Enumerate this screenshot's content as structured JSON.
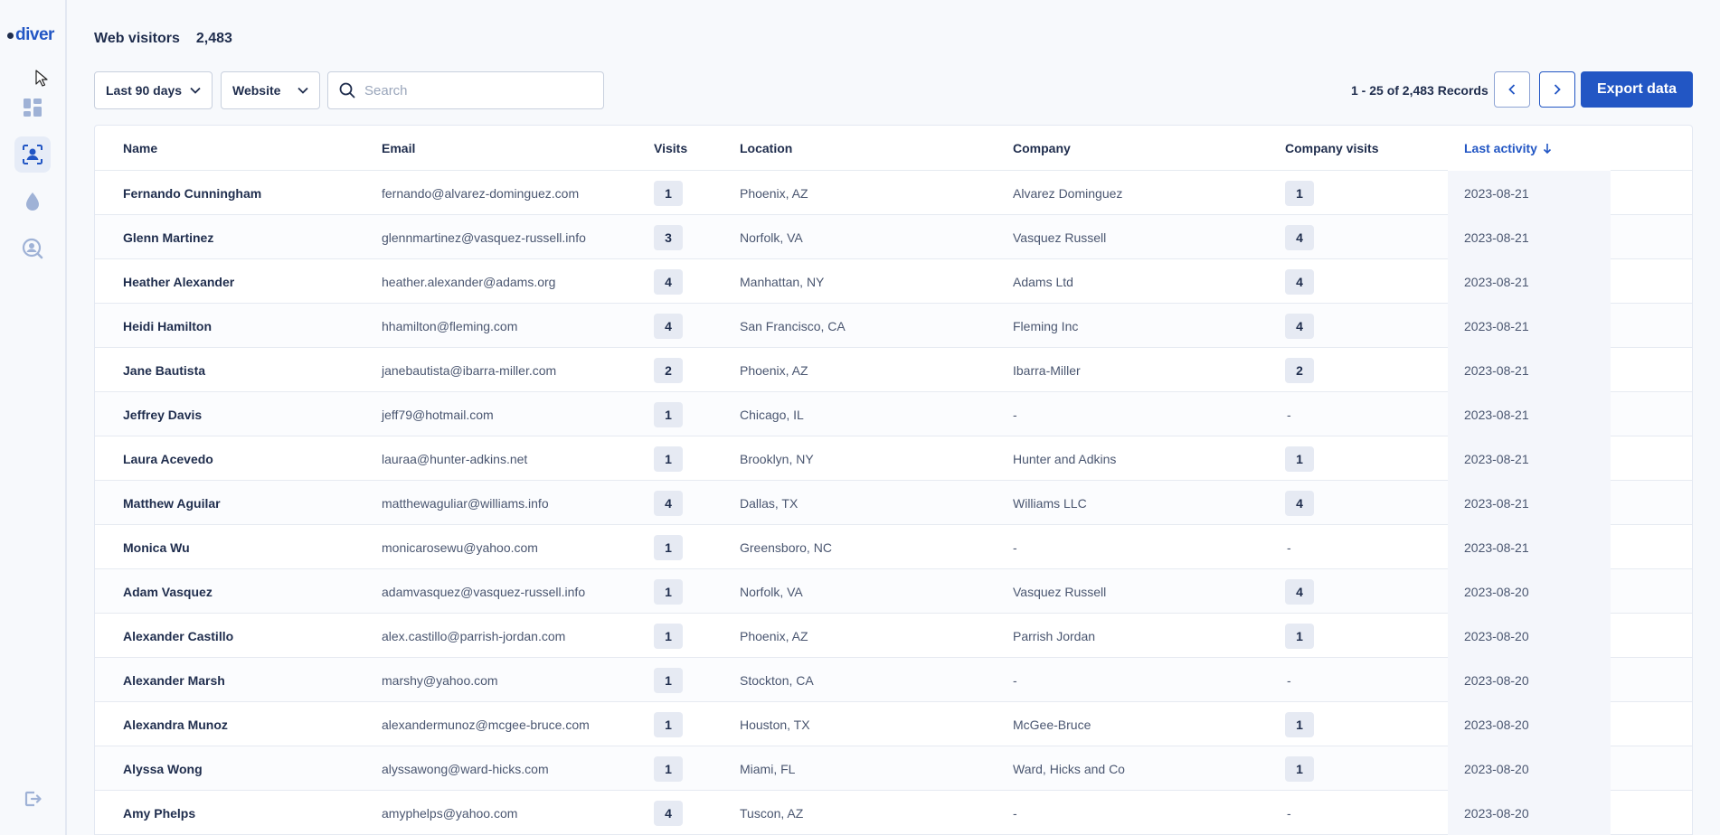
{
  "app": {
    "logo_text": "diver"
  },
  "sidebar": {
    "items": [
      {
        "name": "dashboard",
        "icon": "dashboard-icon"
      },
      {
        "name": "visitors",
        "icon": "visitor-scan-icon",
        "active": true
      },
      {
        "name": "intent",
        "icon": "droplet-icon"
      },
      {
        "name": "search-people",
        "icon": "search-person-icon"
      }
    ],
    "bottom": {
      "name": "logout",
      "icon": "logout-icon"
    }
  },
  "header": {
    "title": "Web visitors",
    "count": "2,483"
  },
  "toolbar": {
    "period": "Last 90 days",
    "source": "Website",
    "search_placeholder": "Search",
    "records": "1 - 25 of 2,483 Records",
    "export_label": "Export data"
  },
  "table": {
    "columns": {
      "name": "Name",
      "email": "Email",
      "visits": "Visits",
      "location": "Location",
      "company": "Company",
      "company_visits": "Company visits",
      "last_activity": "Last activity"
    },
    "rows": [
      {
        "name": "Fernando Cunningham",
        "email": "fernando@alvarez-dominguez.com",
        "visits": "1",
        "location": "Phoenix, AZ",
        "company": "Alvarez Dominguez",
        "company_visits": "1",
        "last_activity": "2023-08-21"
      },
      {
        "name": "Glenn Martinez",
        "email": "glennmartinez@vasquez-russell.info",
        "visits": "3",
        "location": "Norfolk, VA",
        "company": "Vasquez Russell",
        "company_visits": "4",
        "last_activity": "2023-08-21"
      },
      {
        "name": "Heather Alexander",
        "email": "heather.alexander@adams.org",
        "visits": "4",
        "location": "Manhattan, NY",
        "company": "Adams Ltd",
        "company_visits": "4",
        "last_activity": "2023-08-21"
      },
      {
        "name": "Heidi Hamilton",
        "email": "hhamilton@fleming.com",
        "visits": "4",
        "location": "San Francisco, CA",
        "company": "Fleming Inc",
        "company_visits": "4",
        "last_activity": "2023-08-21"
      },
      {
        "name": "Jane Bautista",
        "email": "janebautista@ibarra-miller.com",
        "visits": "2",
        "location": "Phoenix, AZ",
        "company": "Ibarra-Miller",
        "company_visits": "2",
        "last_activity": "2023-08-21"
      },
      {
        "name": "Jeffrey Davis",
        "email": "jeff79@hotmail.com",
        "visits": "1",
        "location": "Chicago, IL",
        "company": "-",
        "company_visits": "-",
        "last_activity": "2023-08-21"
      },
      {
        "name": "Laura Acevedo",
        "email": "lauraa@hunter-adkins.net",
        "visits": "1",
        "location": "Brooklyn, NY",
        "company": "Hunter and Adkins",
        "company_visits": "1",
        "last_activity": "2023-08-21"
      },
      {
        "name": "Matthew Aguilar",
        "email": "matthewaguliar@williams.info",
        "visits": "4",
        "location": "Dallas, TX",
        "company": "Williams LLC",
        "company_visits": "4",
        "last_activity": "2023-08-21"
      },
      {
        "name": "Monica Wu",
        "email": "monicarosewu@yahoo.com",
        "visits": "1",
        "location": "Greensboro, NC",
        "company": "-",
        "company_visits": "-",
        "last_activity": "2023-08-21"
      },
      {
        "name": "Adam Vasquez",
        "email": "adamvasquez@vasquez-russell.info",
        "visits": "1",
        "location": "Norfolk, VA",
        "company": "Vasquez Russell",
        "company_visits": "4",
        "last_activity": "2023-08-20"
      },
      {
        "name": "Alexander Castillo",
        "email": "alex.castillo@parrish-jordan.com",
        "visits": "1",
        "location": "Phoenix, AZ",
        "company": "Parrish Jordan",
        "company_visits": "1",
        "last_activity": "2023-08-20"
      },
      {
        "name": "Alexander Marsh",
        "email": "marshy@yahoo.com",
        "visits": "1",
        "location": "Stockton, CA",
        "company": "-",
        "company_visits": "-",
        "last_activity": "2023-08-20"
      },
      {
        "name": "Alexandra Munoz",
        "email": "alexandermunoz@mcgee-bruce.com",
        "visits": "1",
        "location": "Houston, TX",
        "company": "McGee-Bruce",
        "company_visits": "1",
        "last_activity": "2023-08-20"
      },
      {
        "name": "Alyssa Wong",
        "email": "alyssawong@ward-hicks.com",
        "visits": "1",
        "location": "Miami, FL",
        "company": "Ward, Hicks and Co",
        "company_visits": "1",
        "last_activity": "2023-08-20"
      },
      {
        "name": "Amy Phelps",
        "email": "amyphelps@yahoo.com",
        "visits": "4",
        "location": "Tuscon, AZ",
        "company": "-",
        "company_visits": "-",
        "last_activity": "2023-08-20"
      }
    ]
  },
  "colors": {
    "accent": "#2256c4",
    "text": "#1f2d4d",
    "muted": "#4a5670",
    "pill_bg": "#e6eaf3"
  }
}
